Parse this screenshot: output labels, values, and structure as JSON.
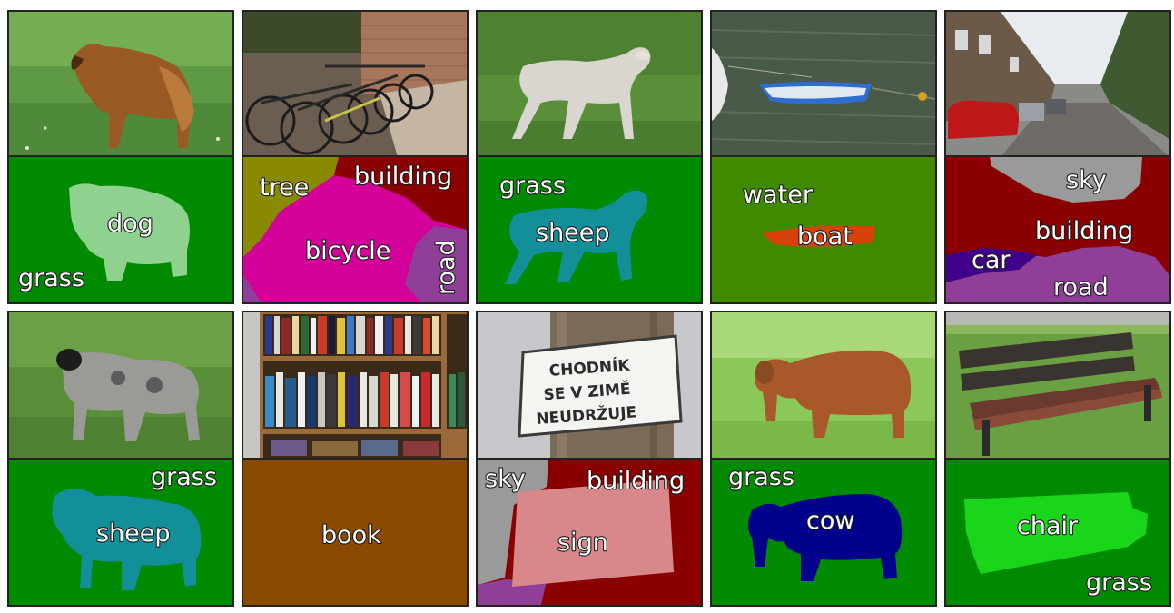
{
  "figure": {
    "columns": [
      {
        "photo": {
          "subject": "dog"
        },
        "segmentation": {
          "labels": {
            "dog": "dog",
            "grass": "grass"
          }
        }
      },
      {
        "photo": {
          "subject": "bicycles"
        },
        "segmentation": {
          "labels": {
            "tree": "tree",
            "building": "building",
            "bicycle": "bicycle",
            "road": "road"
          }
        }
      },
      {
        "photo": {
          "subject": "sheep"
        },
        "segmentation": {
          "labels": {
            "grass": "grass",
            "sheep": "sheep"
          }
        }
      },
      {
        "photo": {
          "subject": "boat"
        },
        "segmentation": {
          "labels": {
            "water": "water",
            "boat": "boat"
          }
        }
      },
      {
        "photo": {
          "subject": "street"
        },
        "segmentation": {
          "labels": {
            "sky": "sky",
            "building": "building",
            "car": "car",
            "road": "road"
          }
        }
      },
      {
        "photo": {
          "subject": "sheep"
        },
        "segmentation": {
          "labels": {
            "grass": "grass",
            "sheep": "sheep"
          }
        }
      },
      {
        "photo": {
          "subject": "bookshelf"
        },
        "segmentation": {
          "labels": {
            "book": "book"
          }
        }
      },
      {
        "photo": {
          "subject": "sign",
          "sign_text": [
            "CHODNÍK",
            "SE V ZIMĚ",
            "NEUDRŽUJE"
          ]
        },
        "segmentation": {
          "labels": {
            "sky": "sky",
            "building": "building",
            "sign": "sign"
          }
        }
      },
      {
        "photo": {
          "subject": "cow"
        },
        "segmentation": {
          "labels": {
            "grass": "grass",
            "cow": "cow"
          }
        }
      },
      {
        "photo": {
          "subject": "bench"
        },
        "segmentation": {
          "labels": {
            "chair": "chair",
            "grass": "grass"
          }
        }
      }
    ]
  },
  "colors": {
    "grass": "#008a00",
    "dog": "#8fd28f",
    "sheep": "#138f9a",
    "tree": "#8a8a00",
    "building": "#8a0000",
    "bicycle": "#d4009a",
    "road": "#8f3f97",
    "water": "#3f8a00",
    "boat": "#d8420a",
    "sky": "#9a9a9a",
    "car": "#3f008a",
    "book": "#8a4a00",
    "sign": "#d8888a",
    "cow": "#00008a",
    "chair": "#1ad61a"
  }
}
